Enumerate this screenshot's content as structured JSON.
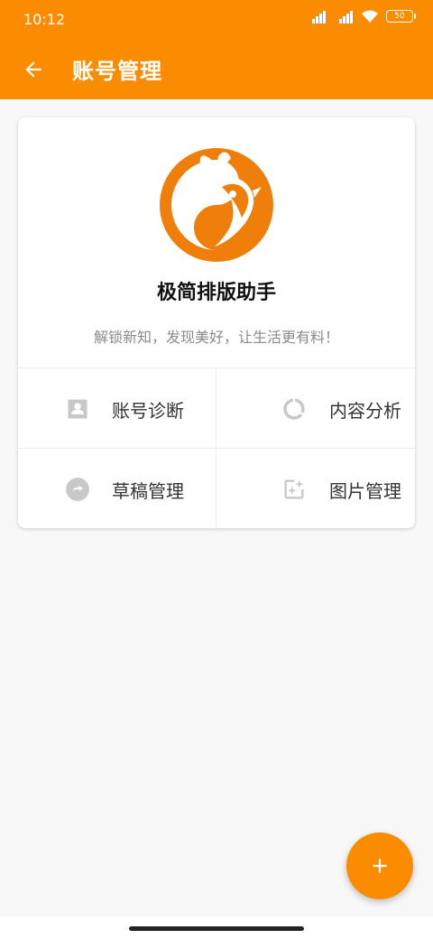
{
  "status_bar": {
    "time": "10:12",
    "battery": "50"
  },
  "app_bar": {
    "title": "账号管理",
    "back_icon": "arrow-left-icon"
  },
  "profile": {
    "name": "极简排版助手",
    "slogan": "解锁新知，发现美好，让生活更有料！",
    "logo_icon": "bird-logo-icon"
  },
  "menu": [
    {
      "label": "账号诊断",
      "icon": "account-box-icon"
    },
    {
      "label": "内容分析",
      "icon": "donut-chart-icon"
    },
    {
      "label": "草稿管理",
      "icon": "draft-circle-icon"
    },
    {
      "label": "图片管理",
      "icon": "image-sparkle-icon"
    }
  ],
  "fab": {
    "icon": "plus-icon"
  },
  "colors": {
    "accent": "#fb8c00",
    "icon_gray": "#c8c8c8"
  }
}
